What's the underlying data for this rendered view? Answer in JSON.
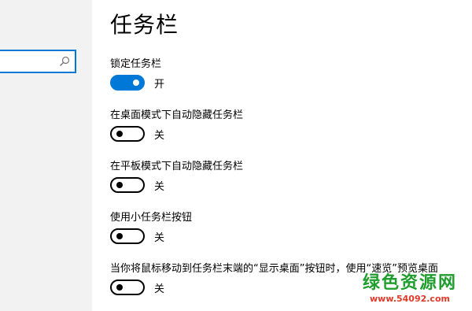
{
  "search": {
    "value": "",
    "placeholder": ""
  },
  "page_title": "任务栏",
  "settings": [
    {
      "label": "锁定任务栏",
      "state_text": "开",
      "on": true
    },
    {
      "label": "在桌面模式下自动隐藏任务栏",
      "state_text": "关",
      "on": false
    },
    {
      "label": "在平板模式下自动隐藏任务栏",
      "state_text": "关",
      "on": false
    },
    {
      "label": "使用小任务栏按钮",
      "state_text": "关",
      "on": false
    },
    {
      "label": "当你将鼠标移动到任务栏末端的“显示桌面”按钮时，使用“速览”预览桌面",
      "state_text": "关",
      "on": false
    }
  ],
  "watermark": {
    "text": "绿色资源网",
    "url": "www.54092.com"
  },
  "colors": {
    "accent": "#0078d7",
    "nav_bg": "#f2f2f2",
    "watermark_green": "#1f9d2d",
    "watermark_red": "#e03a2a"
  },
  "icons": {
    "search": "search-icon"
  }
}
